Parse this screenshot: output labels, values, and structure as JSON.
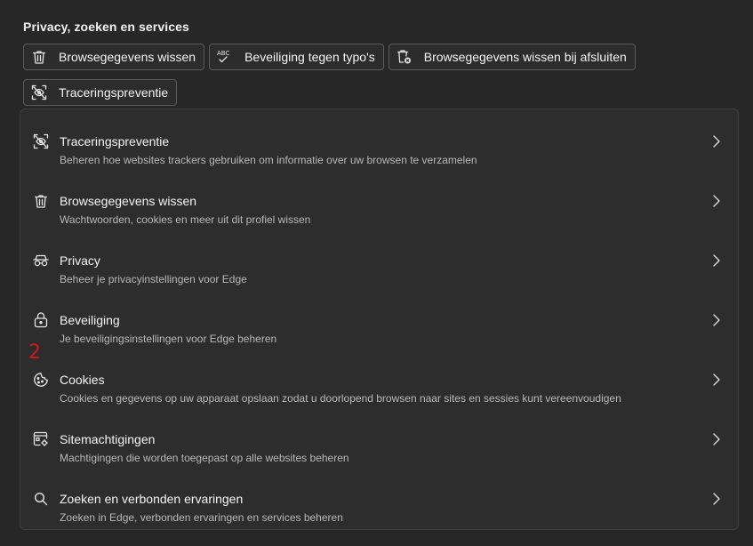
{
  "section": {
    "title": "Privacy, zoeken en services"
  },
  "chips": [
    {
      "label": "Browsegegevens wissen",
      "icon": "trash-icon"
    },
    {
      "label": "Beveiliging tegen typo's",
      "icon": "spellcheck-abc-icon"
    },
    {
      "label": "Browsegegevens wissen bij afsluiten",
      "icon": "trash-close-icon"
    },
    {
      "label": "Traceringspreventie",
      "icon": "tracking-prevention-icon"
    }
  ],
  "items": [
    {
      "title": "Traceringspreventie",
      "subtitle": "Beheren hoe websites trackers gebruiken om informatie over uw browsen te verzamelen",
      "icon": "tracking-prevention-icon"
    },
    {
      "title": "Browsegegevens wissen",
      "subtitle": "Wachtwoorden, cookies en meer uit dit profiel wissen",
      "icon": "trash-icon"
    },
    {
      "title": "Privacy",
      "subtitle": "Beheer je privacyinstellingen voor Edge",
      "icon": "incognito-glasses-icon"
    },
    {
      "title": "Beveiliging",
      "subtitle": "Je beveiligingsinstellingen voor Edge beheren",
      "icon": "lock-icon"
    },
    {
      "title": "Cookies",
      "subtitle": "Cookies en gegevens op uw apparaat opslaan zodat u doorlopend browsen naar sites en sessies kunt vereenvoudigen",
      "icon": "cookie-icon"
    },
    {
      "title": "Sitemachtigingen",
      "subtitle": "Machtigingen die worden toegepast op alle websites beheren",
      "icon": "site-permissions-icon"
    },
    {
      "title": "Zoeken en verbonden ervaringen",
      "subtitle": "Zoeken in Edge, verbonden ervaringen en services beheren",
      "icon": "search-icon"
    }
  ],
  "annotation": {
    "marker": "2",
    "color": "#d01818"
  },
  "colors": {
    "background": "#272727",
    "card": "#2d2d2d",
    "text": "#f5f5f5",
    "subtext": "#b8b8b8"
  }
}
